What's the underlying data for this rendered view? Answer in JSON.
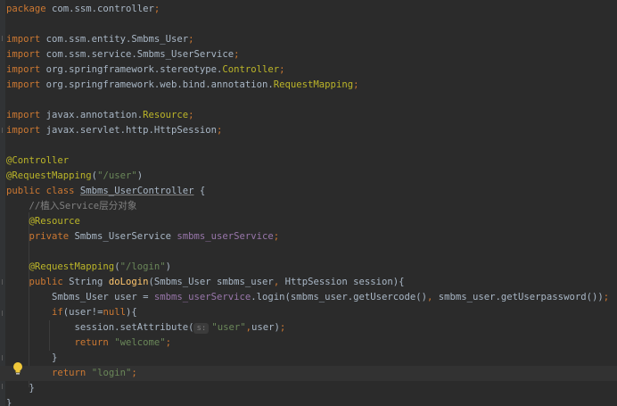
{
  "editor": {
    "language": "java",
    "file_kind": "java-source",
    "colors": {
      "background": "#2b2b2b",
      "keyword": "#cc7832",
      "annotation": "#bbb529",
      "string": "#6a8759",
      "comment": "#808080",
      "field": "#9876aa",
      "method_decl": "#ffc66d",
      "text": "#a9b7c6"
    },
    "lines": [
      {
        "tokens": [
          [
            "kw",
            "package "
          ],
          [
            "t",
            "com.ssm.controller"
          ],
          [
            "kw",
            ";"
          ]
        ]
      },
      {
        "tokens": []
      },
      {
        "tokens": [
          [
            "kw",
            "import "
          ],
          [
            "t",
            "com.ssm.entity.Smbms_User"
          ],
          [
            "kw",
            ";"
          ]
        ]
      },
      {
        "tokens": [
          [
            "kw",
            "import "
          ],
          [
            "t",
            "com.ssm.service.Smbms_UserService"
          ],
          [
            "kw",
            ";"
          ]
        ]
      },
      {
        "tokens": [
          [
            "kw",
            "import "
          ],
          [
            "t",
            "org.springframework.stereotype."
          ],
          [
            "ann",
            "Controller"
          ],
          [
            "kw",
            ";"
          ]
        ]
      },
      {
        "tokens": [
          [
            "kw",
            "import "
          ],
          [
            "t",
            "org.springframework.web.bind.annotation."
          ],
          [
            "ann",
            "RequestMapping"
          ],
          [
            "kw",
            ";"
          ]
        ]
      },
      {
        "tokens": []
      },
      {
        "tokens": [
          [
            "kw",
            "import "
          ],
          [
            "t",
            "javax.annotation."
          ],
          [
            "ann",
            "Resource"
          ],
          [
            "kw",
            ";"
          ]
        ]
      },
      {
        "tokens": [
          [
            "kw",
            "import "
          ],
          [
            "t",
            "javax.servlet.http.HttpSession"
          ],
          [
            "kw",
            ";"
          ]
        ]
      },
      {
        "tokens": []
      },
      {
        "tokens": [
          [
            "ann",
            "@Controller"
          ]
        ]
      },
      {
        "tokens": [
          [
            "ann",
            "@RequestMapping"
          ],
          [
            "t",
            "("
          ],
          [
            "str",
            "\"/user\""
          ],
          [
            "t",
            ")"
          ]
        ]
      },
      {
        "tokens": [
          [
            "kw",
            "public class "
          ],
          [
            "cls",
            "Smbms_UserController"
          ],
          [
            "t",
            " {"
          ]
        ]
      },
      {
        "tokens": [
          [
            "t",
            "    "
          ],
          [
            "cmt",
            "//植入Service层分对象"
          ]
        ]
      },
      {
        "tokens": [
          [
            "t",
            "    "
          ],
          [
            "ann",
            "@Resource"
          ]
        ]
      },
      {
        "tokens": [
          [
            "t",
            "    "
          ],
          [
            "kw",
            "private "
          ],
          [
            "t",
            "Smbms_UserService "
          ],
          [
            "field",
            "smbms_userService"
          ],
          [
            "kw",
            ";"
          ]
        ]
      },
      {
        "tokens": []
      },
      {
        "tokens": [
          [
            "t",
            "    "
          ],
          [
            "ann",
            "@RequestMapping"
          ],
          [
            "t",
            "("
          ],
          [
            "str",
            "\"/login\""
          ],
          [
            "t",
            ")"
          ]
        ]
      },
      {
        "tokens": [
          [
            "t",
            "    "
          ],
          [
            "kw",
            "public "
          ],
          [
            "t",
            "String "
          ],
          [
            "fn",
            "doLogin"
          ],
          [
            "t",
            "(Smbms_User smbms_user"
          ],
          [
            "kw",
            ", "
          ],
          [
            "t",
            "HttpSession session){"
          ]
        ]
      },
      {
        "tokens": [
          [
            "t",
            "        Smbms_User user = "
          ],
          [
            "field",
            "smbms_userService"
          ],
          [
            "t",
            ".login(smbms_user.getUsercode()"
          ],
          [
            "kw",
            ", "
          ],
          [
            "t",
            "smbms_user.getUserpassword())"
          ],
          [
            "kw",
            ";"
          ]
        ]
      },
      {
        "tokens": [
          [
            "t",
            "        "
          ],
          [
            "kw",
            "if"
          ],
          [
            "t",
            "(user!="
          ],
          [
            "kw",
            "null"
          ],
          [
            "t",
            "){"
          ]
        ]
      },
      {
        "tokens": [
          [
            "t",
            "            session.setAttribute("
          ],
          [
            "hint",
            "s:"
          ],
          [
            "str",
            "\"user\""
          ],
          [
            "kw",
            ","
          ],
          [
            "t",
            "user)"
          ],
          [
            "kw",
            ";"
          ]
        ]
      },
      {
        "tokens": [
          [
            "t",
            "            "
          ],
          [
            "kw",
            "return "
          ],
          [
            "str",
            "\"welcome\""
          ],
          [
            "kw",
            ";"
          ]
        ]
      },
      {
        "tokens": [
          [
            "t",
            "        }"
          ]
        ]
      },
      {
        "tokens": [
          [
            "t",
            "        "
          ],
          [
            "kw",
            "return "
          ],
          [
            "str",
            "\"login\""
          ],
          [
            "kw",
            ";"
          ]
        ]
      },
      {
        "tokens": [
          [
            "t",
            "    }"
          ]
        ]
      },
      {
        "tokens": [
          [
            "t",
            "}"
          ]
        ]
      }
    ],
    "current_line_index": 24,
    "intention_icon": "lightbulb-icon"
  }
}
